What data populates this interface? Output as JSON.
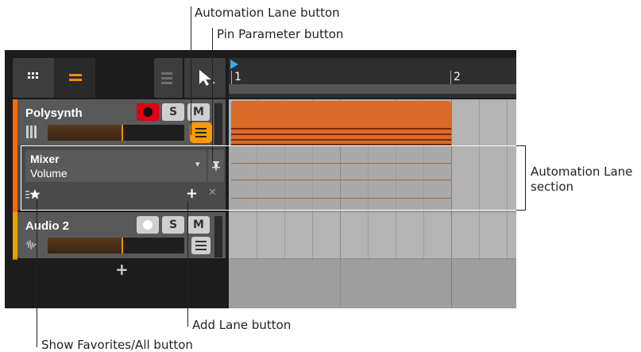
{
  "annotations": {
    "automation_lane_button": "Automation Lane button",
    "pin_parameter_button": "Pin Parameter button",
    "automation_lane_section_line1": "Automation Lane",
    "automation_lane_section_line2": "section",
    "add_lane_button": "Add Lane button",
    "show_favorites_button": "Show Favorites/All button"
  },
  "ruler": {
    "bar1": "1",
    "bar2": "2"
  },
  "tracks": [
    {
      "name": "Polysynth",
      "record": "●",
      "solo": "S",
      "mute": "M",
      "color": "#ff6a00",
      "record_armed": true
    },
    {
      "name": "Audio 2",
      "record": "●",
      "solo": "S",
      "mute": "M",
      "color": "#e3a300",
      "record_armed": false
    }
  ],
  "automation": {
    "device": "Mixer",
    "parameter": "Volume",
    "dropdown": "▾",
    "pin": "⊥",
    "add": "+",
    "close": "✕"
  },
  "add_track": "+",
  "icons": {
    "grid": "grid-view-icon",
    "list": "list-view-icon",
    "pointer": "pointer-tool-icon",
    "lines": "lane-icon"
  },
  "colors": {
    "clip": "#d96a28",
    "accent": "#ff6a00",
    "playhead": "#3da8e6"
  }
}
